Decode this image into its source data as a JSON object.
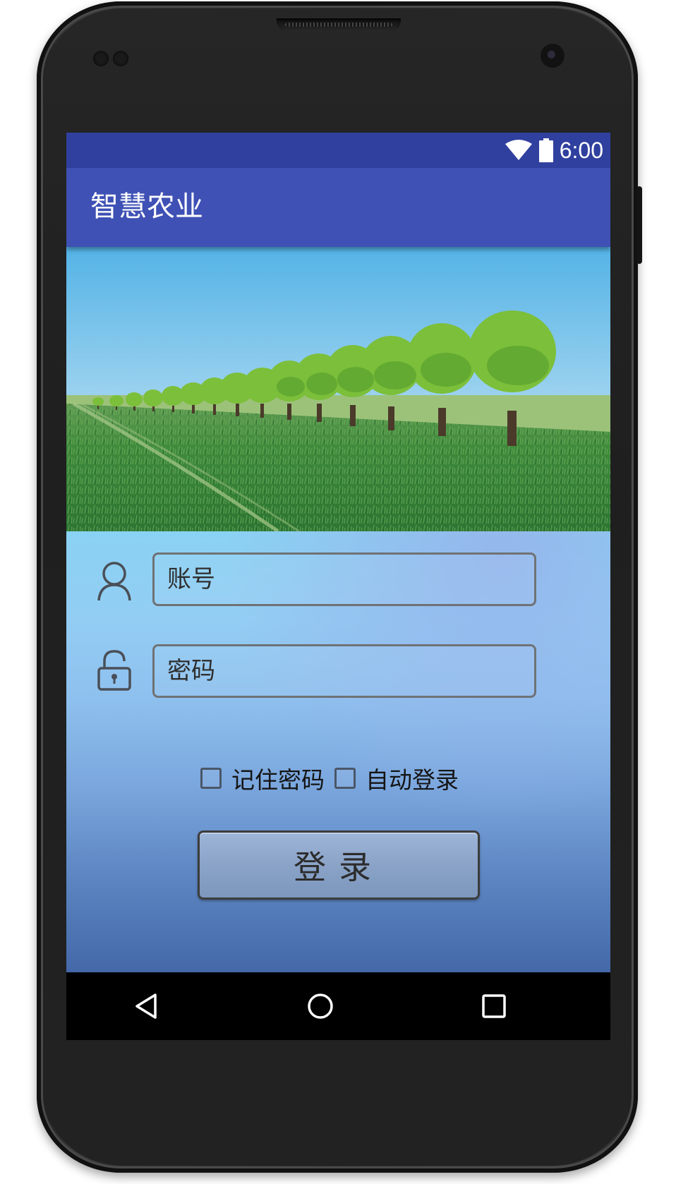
{
  "status_bar": {
    "time": "6:00",
    "wifi_icon": "wifi-icon",
    "battery_icon": "battery-icon"
  },
  "app_bar": {
    "title": "智慧农业"
  },
  "banner": {
    "image": "farm-field-banner"
  },
  "login_form": {
    "account": {
      "icon": "user-icon",
      "placeholder": "账号",
      "value": ""
    },
    "password": {
      "icon": "lock-icon",
      "placeholder": "密码",
      "value": ""
    },
    "remember_password": {
      "label": "记住密码",
      "checked": false
    },
    "auto_login": {
      "label": "自动登录",
      "checked": false
    },
    "login_button": "登录"
  },
  "nav_bar": {
    "back_icon": "back-icon",
    "home_icon": "home-icon",
    "recents_icon": "recents-icon"
  },
  "colors": {
    "status_bar": "#30409f",
    "app_bar": "#3f51b5"
  }
}
